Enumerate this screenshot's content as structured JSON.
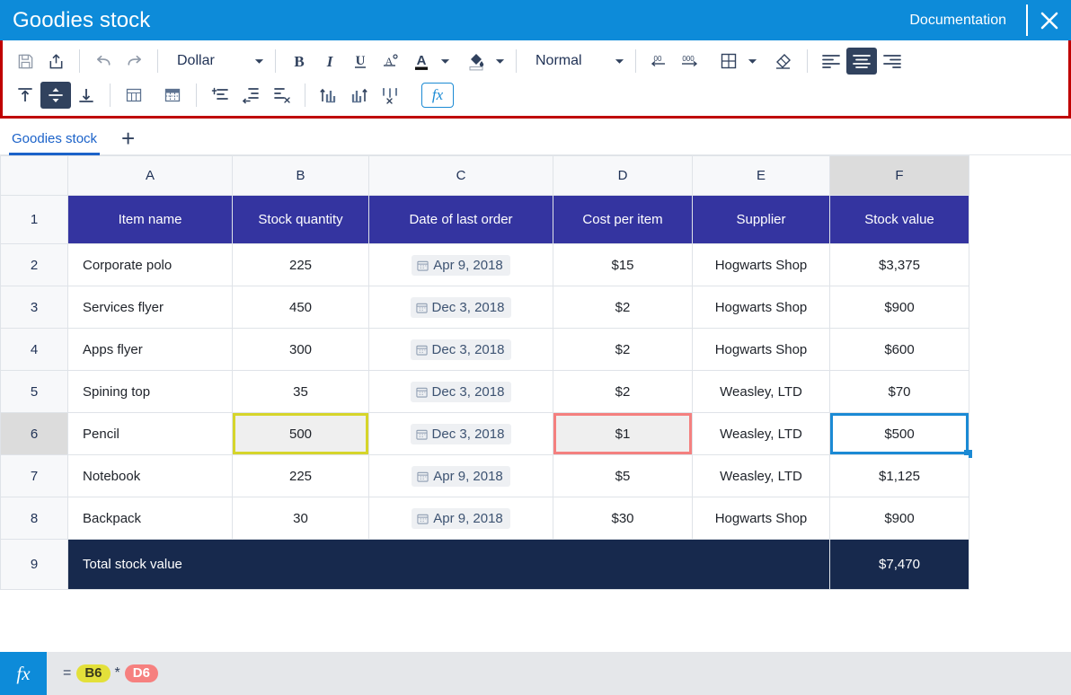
{
  "titlebar": {
    "title": "Goodies stock",
    "documentation_label": "Documentation",
    "close_icon": "close-icon"
  },
  "toolbar": {
    "accent_outline_color": "#c00000",
    "active_bg": "#31425e",
    "row1": [
      {
        "name": "save-button",
        "icon": "floppy-disk-icon",
        "label": ""
      },
      {
        "name": "export-button",
        "icon": "upload-box-icon",
        "label": ""
      },
      {
        "name": "undo-button",
        "icon": "undo-arrow-icon",
        "label": ""
      },
      {
        "name": "redo-button",
        "icon": "redo-arrow-icon",
        "label": ""
      },
      {
        "name": "bold-button",
        "icon": "bold-icon",
        "label": "B"
      },
      {
        "name": "italic-button",
        "icon": "italic-icon",
        "label": "I"
      },
      {
        "name": "underline-button",
        "icon": "underline-icon",
        "label": "U"
      },
      {
        "name": "clear-format-button",
        "icon": "clear-formatting-icon",
        "label": ""
      },
      {
        "name": "font-color-button",
        "icon": "font-color-icon",
        "label": "A"
      },
      {
        "name": "fill-color-button",
        "icon": "fill-color-icon",
        "label": ""
      },
      {
        "name": "decrease-decimal-button",
        "icon": "decrease-decimal-icon",
        "label": ""
      },
      {
        "name": "increase-decimal-button",
        "icon": "increase-decimal-icon",
        "label": ""
      },
      {
        "name": "borders-button",
        "icon": "borders-grid-icon",
        "label": ""
      },
      {
        "name": "clear-button",
        "icon": "eraser-icon",
        "label": ""
      },
      {
        "name": "align-left-button",
        "icon": "align-left-icon",
        "label": ""
      },
      {
        "name": "align-center-button",
        "icon": "align-center-icon",
        "label": ""
      },
      {
        "name": "align-right-button",
        "icon": "align-right-icon",
        "label": ""
      }
    ],
    "row2": [
      {
        "name": "align-top-button",
        "icon": "align-top-icon"
      },
      {
        "name": "align-middle-button",
        "icon": "align-middle-icon"
      },
      {
        "name": "align-bottom-button",
        "icon": "align-bottom-icon"
      },
      {
        "name": "insert-table-button",
        "icon": "insert-table-icon"
      },
      {
        "name": "table-style-button",
        "icon": "table-style-icon"
      },
      {
        "name": "insert-row-button",
        "icon": "insert-row-icon"
      },
      {
        "name": "insert-column-button",
        "icon": "insert-column-icon"
      },
      {
        "name": "delete-row-button",
        "icon": "delete-row-icon"
      },
      {
        "name": "sort-ascending-button",
        "icon": "sort-ascending-icon"
      },
      {
        "name": "sort-descending-button",
        "icon": "sort-descending-icon"
      },
      {
        "name": "clear-sort-button",
        "icon": "clear-sort-icon"
      },
      {
        "name": "insert-function-button",
        "icon": "fx-icon"
      }
    ],
    "number_format": {
      "value": "Dollar",
      "caret": "chevron-down-icon"
    },
    "cell_style": {
      "value": "Normal",
      "caret": "chevron-down-icon"
    },
    "fx_label": "fx"
  },
  "tabs": {
    "items": [
      {
        "label": "Goodies stock",
        "active": true
      }
    ],
    "add_label": "+"
  },
  "sheet": {
    "column_headers": [
      "A",
      "B",
      "C",
      "D",
      "E",
      "F"
    ],
    "selected_column": "F",
    "selected_row": "6",
    "row_numbers": [
      "1",
      "2",
      "3",
      "4",
      "5",
      "6",
      "7",
      "8",
      "9"
    ],
    "header_row": [
      "Item name",
      "Stock quantity",
      "Date of last order",
      "Cost per item",
      "Supplier",
      "Stock value"
    ],
    "rows": [
      {
        "row": "2",
        "item": "Corporate polo",
        "qty": "225",
        "date": "Apr 9, 2018",
        "cost": "$15",
        "supplier": "Hogwarts Shop",
        "value": "$3,375"
      },
      {
        "row": "3",
        "item": "Services flyer",
        "qty": "450",
        "date": "Dec 3, 2018",
        "cost": "$2",
        "supplier": "Hogwarts Shop",
        "value": "$900"
      },
      {
        "row": "4",
        "item": "Apps flyer",
        "qty": "300",
        "date": "Dec 3, 2018",
        "cost": "$2",
        "supplier": "Hogwarts Shop",
        "value": "$600"
      },
      {
        "row": "5",
        "item": "Spining top",
        "qty": "35",
        "date": "Dec 3, 2018",
        "cost": "$2",
        "supplier": "Weasley, LTD",
        "value": "$70"
      },
      {
        "row": "6",
        "item": "Pencil",
        "qty": "500",
        "date": "Dec 3, 2018",
        "cost": "$1",
        "supplier": "Weasley, LTD",
        "value": "$500"
      },
      {
        "row": "7",
        "item": "Notebook",
        "qty": "225",
        "date": "Apr 9, 2018",
        "cost": "$5",
        "supplier": "Weasley, LTD",
        "value": "$1,125"
      },
      {
        "row": "8",
        "item": "Backpack",
        "qty": "30",
        "date": "Apr 9, 2018",
        "cost": "$30",
        "supplier": "Hogwarts Shop",
        "value": "$900"
      }
    ],
    "total_row": {
      "row": "9",
      "label": "Total stock value",
      "value": "$7,470"
    },
    "highlights": {
      "yellow_cell": "B6",
      "red_cell": "D6",
      "blue_cell": "F6",
      "yellow_color": "#d6d52b",
      "red_color": "#f4807f",
      "blue_color": "#1b8ad4"
    },
    "date_icon": "calendar-icon"
  },
  "formula_bar": {
    "fx_label": "fx",
    "equals": "=",
    "ref1": "B6",
    "operator": "*",
    "ref2": "D6"
  }
}
